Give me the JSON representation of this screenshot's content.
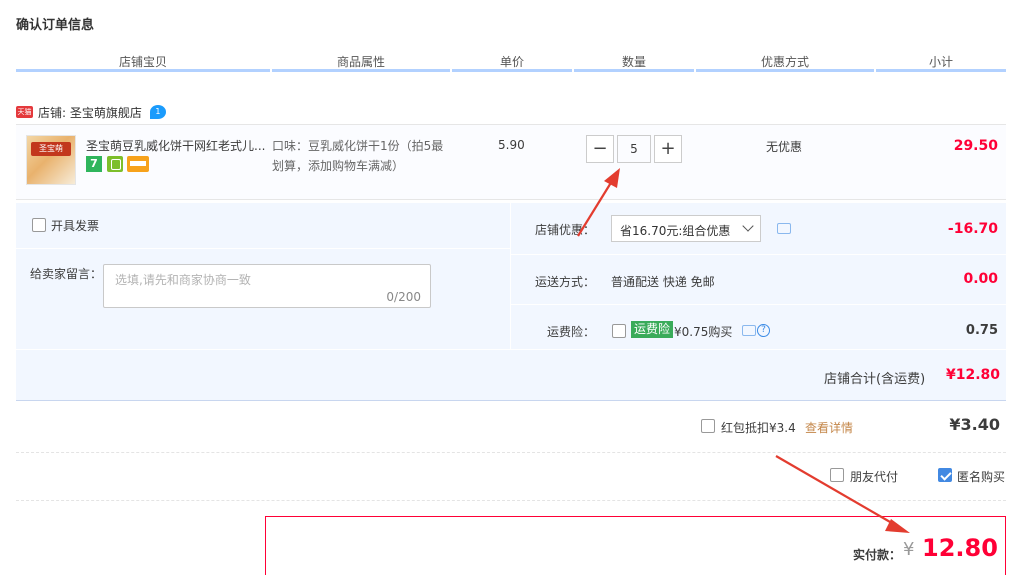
{
  "page": {
    "title": "确认订单信息"
  },
  "columns": [
    "店铺宝贝",
    "商品属性",
    "单价",
    "数量",
    "优惠方式",
    "小计"
  ],
  "shop": {
    "badge": "天猫",
    "label": "店铺: 圣宝萌旗舰店",
    "chat_icon_text": "1"
  },
  "item": {
    "name": "圣宝萌豆乳威化饼干网红老式儿...",
    "attr_line1": "口味：豆乳威化饼干1份（拍5最",
    "attr_line2": "划算，添加购物车满减）",
    "price": "5.90",
    "quantity": "5",
    "minus": "−",
    "plus": "+",
    "discount": "无优惠",
    "subtotal": "29.50",
    "thumb_text": "圣宝萌",
    "service_icons": [
      "seven-day-return-icon",
      "shield-icon",
      "card-icon"
    ],
    "service1_text": "7"
  },
  "options": {
    "invoice_label": "开具发票",
    "memo_label": "给卖家留言：",
    "memo_placeholder": "选填,请先和商家协商一致",
    "memo_count": "0/200",
    "shop_discount_label": "店铺优惠：",
    "shop_discount_value": "省16.70元:组合优惠",
    "shop_discount_amount": "-16.70",
    "shipping_label": "运送方式：",
    "shipping_value": "普通配送 快递 免邮",
    "shipping_amount": "0.00",
    "insurance_label": "运费险：",
    "insurance_badge": "运费险",
    "insurance_value": "¥0.75购买",
    "insurance_amount": "0.75",
    "question_mark": "?",
    "shop_total_label": "店铺合计(含运费)",
    "shop_total_value": "¥12.80"
  },
  "redpacket": {
    "label": "红包抵扣¥3.4",
    "link": "查看详情",
    "amount": "¥3.40"
  },
  "extras": {
    "friend_pay": "朋友代付",
    "anonymous": "匿名购买",
    "anonymous_checked": true
  },
  "payment": {
    "label": "实付款：",
    "currency": "¥",
    "amount": "12.80"
  },
  "colors": {
    "price_red": "#ff0036",
    "accent_blue": "#4289e2",
    "arrow_red": "#e33c2f"
  }
}
